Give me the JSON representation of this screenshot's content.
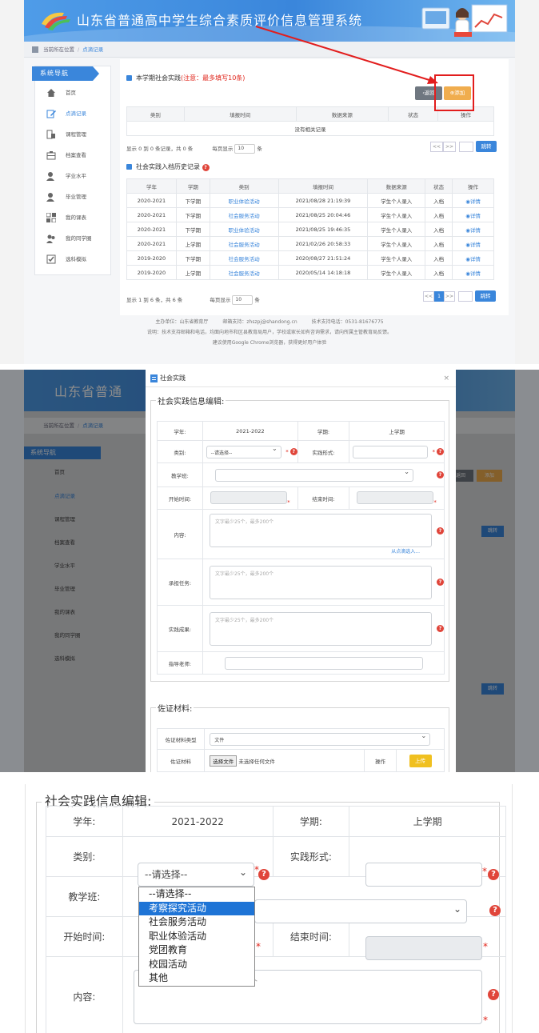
{
  "site": {
    "title": "山东省普通高中学生综合素质评价信息管理系统",
    "title_short": "山东省普通"
  },
  "breadcrumb": {
    "home": "当前所在位置",
    "current": "点滴记录"
  },
  "nav": {
    "header": "系统导航",
    "items": [
      {
        "label": "首页",
        "icon": "home-icon"
      },
      {
        "label": "点滴记录",
        "icon": "pen-icon"
      },
      {
        "label": "课程管理",
        "icon": "book-icon"
      },
      {
        "label": "档案查看",
        "icon": "archive-icon"
      },
      {
        "label": "学业水平",
        "icon": "user-icon"
      },
      {
        "label": "毕业管理",
        "icon": "user-icon"
      },
      {
        "label": "我的课表",
        "icon": "grid-icon"
      },
      {
        "label": "我的同学圈",
        "icon": "group-icon"
      },
      {
        "label": "选科模拟",
        "icon": "check-icon"
      }
    ]
  },
  "practice": {
    "title": "本学期社会实践",
    "notice": "(注意：最多填写10条)",
    "return_label": "返回",
    "add_label": "添加",
    "columns": [
      "类别",
      "填报时间",
      "数据来源",
      "状态",
      "操作"
    ],
    "empty": "没有相关记录",
    "pager_info": "显示 0 到 0 条记录，共 0 条",
    "per_page_prefix": "每页显示",
    "per_page_value": "10",
    "per_page_suffix": "条",
    "prev": "<<",
    "next": ">>",
    "jump": "跳转"
  },
  "history": {
    "title": "社会实践入档历史记录",
    "columns": [
      "学年",
      "学期",
      "类别",
      "填报时间",
      "数据来源",
      "状态",
      "操作"
    ],
    "rows": [
      [
        "2020-2021",
        "下学期",
        "职业体验活动",
        "2021/08/28 21:19:39",
        "学生个人录入",
        "入档",
        "详情"
      ],
      [
        "2020-2021",
        "下学期",
        "社会服务活动",
        "2021/08/25 20:04:46",
        "学生个人录入",
        "入档",
        "详情"
      ],
      [
        "2020-2021",
        "下学期",
        "职业体验活动",
        "2021/08/25 19:46:35",
        "学生个人录入",
        "入档",
        "详情"
      ],
      [
        "2020-2021",
        "上学期",
        "社会服务活动",
        "2021/02/26 20:58:33",
        "学生个人录入",
        "入档",
        "详情"
      ],
      [
        "2019-2020",
        "下学期",
        "社会服务活动",
        "2020/08/27 21:51:24",
        "学生个人录入",
        "入档",
        "详情"
      ],
      [
        "2019-2020",
        "上学期",
        "社会服务活动",
        "2020/05/14 14:18:18",
        "学生个人录入",
        "入档",
        "详情"
      ]
    ],
    "pager_info": "显示 1 到 6 条，共 6 条",
    "page": "1"
  },
  "footer": {
    "line1": "主办单位：山东省教育厅　　　邮箱支持：zhszpj@shandong.cn　　　技术支持电话：0531-81676775",
    "line2": "说明：技术支持邮箱和电话，均面向地市和区县教育局用户，学校或家长如有咨询需求，请向所属主管教育局反馈。",
    "line3": "建议使用Google Chrome浏览器，获得更好用户体验"
  },
  "modal": {
    "title": "社会实践",
    "close": "×",
    "legend": "社会实践信息编辑:",
    "year_label": "学年:",
    "year_value": "2021-2022",
    "term_label": "学期:",
    "term_value": "上学期",
    "category_label": "类别:",
    "category_value": "--请选择--",
    "form_label": "实践形式:",
    "class_label": "教学班:",
    "start_label": "开始时间:",
    "end_label": "结束时间:",
    "content_label": "内容:",
    "content_placeholder": "文字最少25个，最多200个",
    "from_record": "从点滴选入...",
    "task_label": "承担任务:",
    "task_placeholder": "文字最少25个，最多200个",
    "result_label": "实践成果:",
    "result_placeholder": "文字最少25个，最多200个",
    "teacher_label": "指导老师:",
    "evidence_legend": "佐证材料:",
    "evidence_type_label": "佐证材料类型",
    "evidence_type_value": "文件",
    "evidence_label": "佐证材料",
    "choose_file": "选择文件",
    "no_file": "未选择任何文件",
    "op_label": "操作",
    "upload": "上传"
  },
  "dropdown": {
    "options": [
      "--请选择--",
      "考察探究活动",
      "社会服务活动",
      "职业体验活动",
      "党团教育",
      "校园活动",
      "其他"
    ],
    "highlighted": "考察探究活动"
  },
  "colors": {
    "primary": "#3a86db",
    "add": "#f0ad4e",
    "warn": "#e0453a",
    "highlight": "#1e74d6"
  }
}
